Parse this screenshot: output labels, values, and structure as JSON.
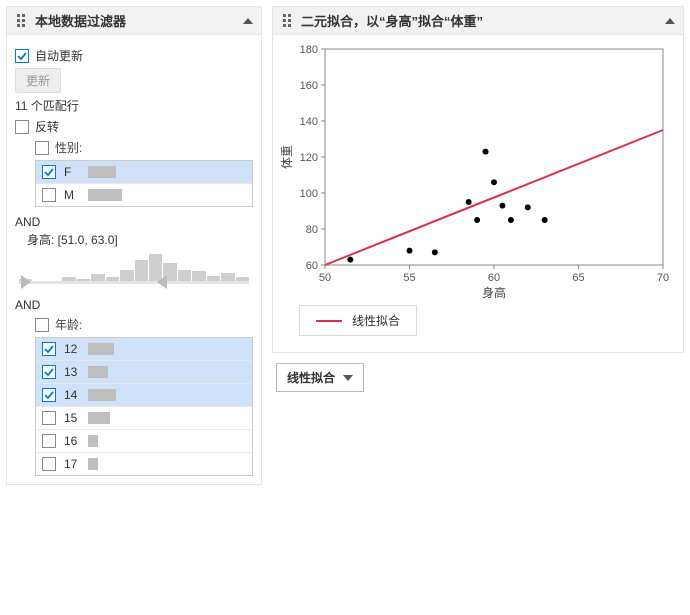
{
  "left": {
    "title": "本地数据过滤器",
    "autoUpdate": "自动更新",
    "updateBtn": "更新",
    "matchText": "11 个匹配行",
    "invert": "反转",
    "and": "AND",
    "sex": {
      "label": "性别:",
      "opts": [
        {
          "label": "F",
          "checked": true,
          "bar": 28
        },
        {
          "label": "M",
          "checked": false,
          "bar": 34
        }
      ]
    },
    "height": {
      "label": "身高: [51.0, 63.0]",
      "bins": [
        2,
        0,
        0,
        3,
        2,
        5,
        3,
        8,
        14,
        18,
        12,
        8,
        7,
        4,
        6,
        3
      ]
    },
    "age": {
      "label": "年龄:",
      "opts": [
        {
          "label": "12",
          "checked": true,
          "bar": 26
        },
        {
          "label": "13",
          "checked": true,
          "bar": 20
        },
        {
          "label": "14",
          "checked": true,
          "bar": 28
        },
        {
          "label": "15",
          "checked": false,
          "bar": 22
        },
        {
          "label": "16",
          "checked": false,
          "bar": 10
        },
        {
          "label": "17",
          "checked": false,
          "bar": 10
        }
      ]
    }
  },
  "right": {
    "title": "二元拟合，以“身高”拟合“体重”",
    "legend": "线性拟合",
    "dropdown": "线性拟合"
  },
  "chart_data": {
    "type": "scatter",
    "xlabel": "身高",
    "ylabel": "体重",
    "xlim": [
      50,
      70
    ],
    "ylim": [
      60,
      180
    ],
    "xticks": [
      50,
      55,
      60,
      65,
      70
    ],
    "yticks": [
      60,
      80,
      100,
      120,
      140,
      160,
      180
    ],
    "points": [
      {
        "x": 51.5,
        "y": 63
      },
      {
        "x": 55,
        "y": 68
      },
      {
        "x": 56.5,
        "y": 67
      },
      {
        "x": 58.5,
        "y": 95
      },
      {
        "x": 59,
        "y": 85
      },
      {
        "x": 59.5,
        "y": 123
      },
      {
        "x": 60,
        "y": 106
      },
      {
        "x": 60.5,
        "y": 93
      },
      {
        "x": 61,
        "y": 85
      },
      {
        "x": 62,
        "y": 92
      },
      {
        "x": 63,
        "y": 85
      }
    ],
    "fit_line": {
      "x1": 50,
      "y1": 60,
      "x2": 70,
      "y2": 135
    },
    "legend_label": "线性拟合"
  }
}
